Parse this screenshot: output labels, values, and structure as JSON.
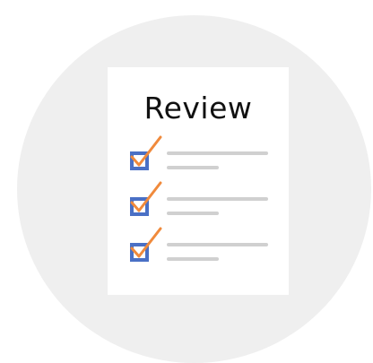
{
  "title": "Review",
  "colors": {
    "background_circle": "#efefef",
    "paper": "#ffffff",
    "checkbox_border": "#4a70c5",
    "checkmark": "#f08a3c",
    "placeholder_line": "#d0d0d0"
  },
  "checklist": {
    "items": [
      {
        "checked": true,
        "icon": "checkbox-checked-icon"
      },
      {
        "checked": true,
        "icon": "checkbox-checked-icon"
      },
      {
        "checked": true,
        "icon": "checkbox-checked-icon"
      }
    ]
  }
}
